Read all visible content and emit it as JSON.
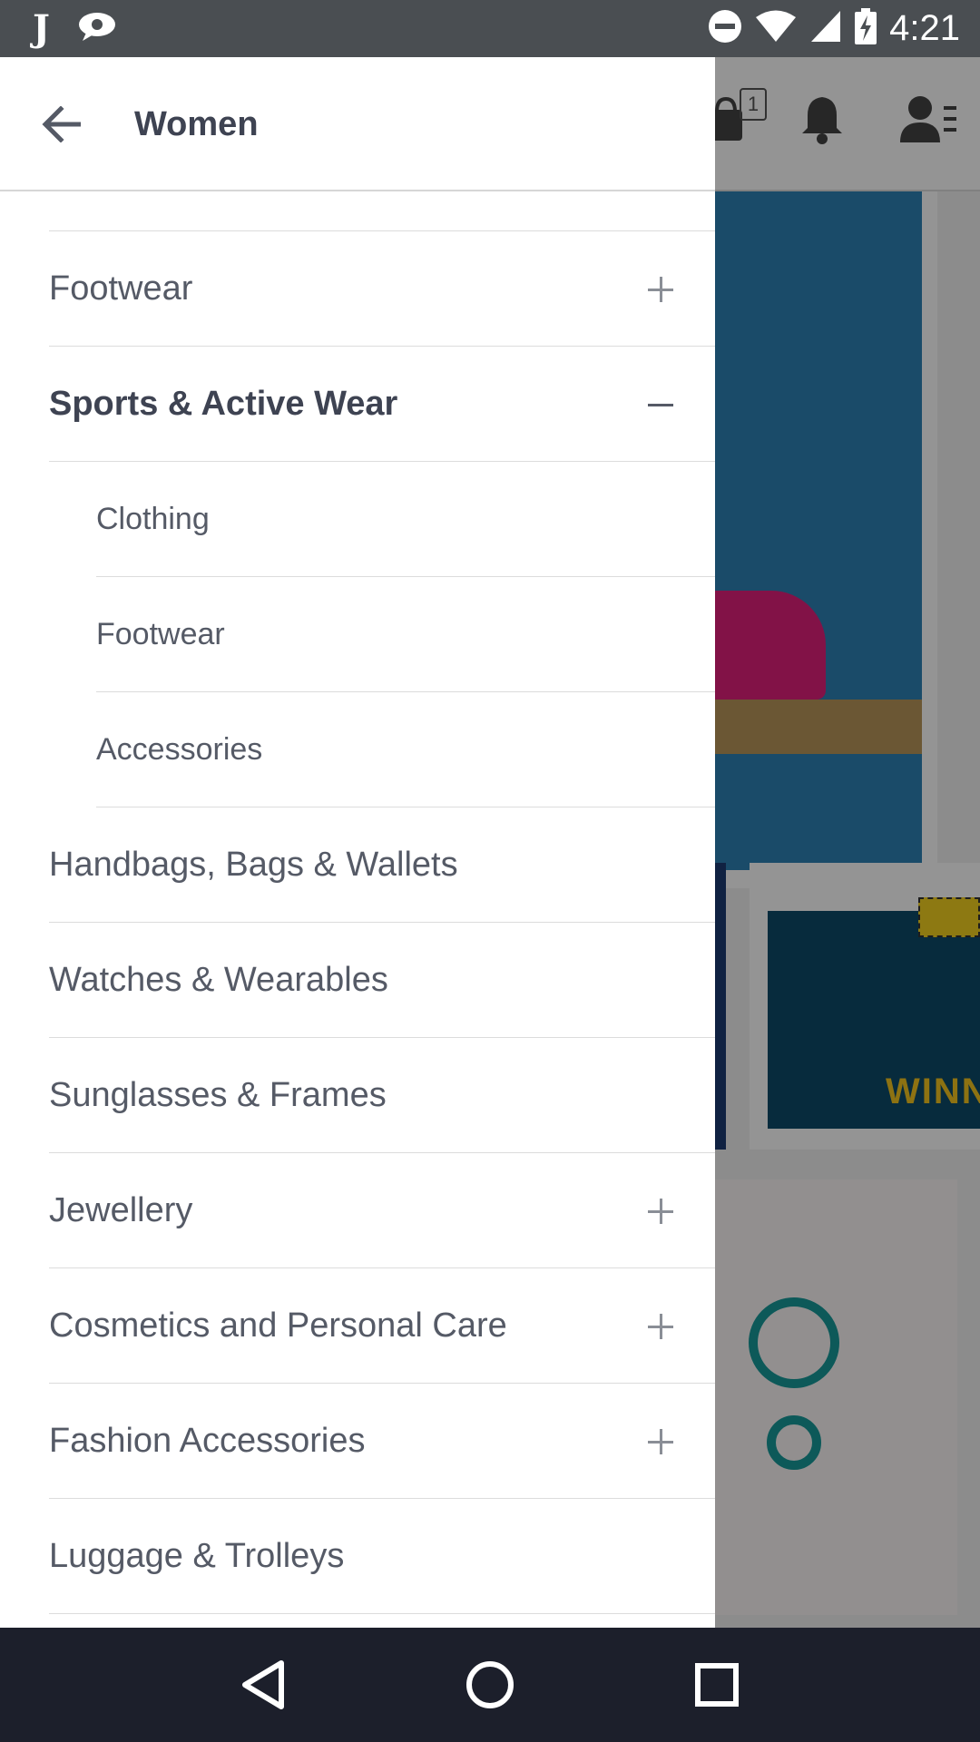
{
  "status_bar": {
    "time": "4:21",
    "left_icons": [
      "j-app-icon",
      "chat-bubble-icon"
    ],
    "right_icons": [
      "do-not-disturb-icon",
      "wifi-icon",
      "cell-signal-icon",
      "battery-charging-icon"
    ]
  },
  "background_app": {
    "cart_badge": "1",
    "banner_text": "WINN"
  },
  "drawer": {
    "title": "Women",
    "items": [
      {
        "label": "Footwear",
        "level": 0,
        "toggle": "plus"
      },
      {
        "label": "Sports & Active Wear",
        "level": 0,
        "toggle": "minus"
      },
      {
        "label": "Clothing",
        "level": 1,
        "toggle": "none"
      },
      {
        "label": "Footwear",
        "level": 1,
        "toggle": "none"
      },
      {
        "label": "Accessories",
        "level": 1,
        "toggle": "none"
      },
      {
        "label": "Handbags, Bags & Wallets",
        "level": 0,
        "toggle": "none"
      },
      {
        "label": "Watches & Wearables",
        "level": 0,
        "toggle": "none"
      },
      {
        "label": "Sunglasses & Frames",
        "level": 0,
        "toggle": "none"
      },
      {
        "label": "Jewellery",
        "level": 0,
        "toggle": "plus"
      },
      {
        "label": "Cosmetics and Personal Care",
        "level": 0,
        "toggle": "plus"
      },
      {
        "label": "Fashion Accessories",
        "level": 0,
        "toggle": "plus"
      },
      {
        "label": "Luggage & Trolleys",
        "level": 0,
        "toggle": "none"
      }
    ]
  },
  "nav_bar": {
    "buttons": [
      "back-triangle-icon",
      "home-circle-icon",
      "recents-square-icon"
    ]
  },
  "colors": {
    "status_bar": "#4a4e52",
    "nav_bar": "#1c1f2b",
    "drawer_bg": "#ffffff",
    "text_primary": "#3e4352",
    "text_secondary": "#555a66",
    "divider": "#dcdcdc"
  }
}
